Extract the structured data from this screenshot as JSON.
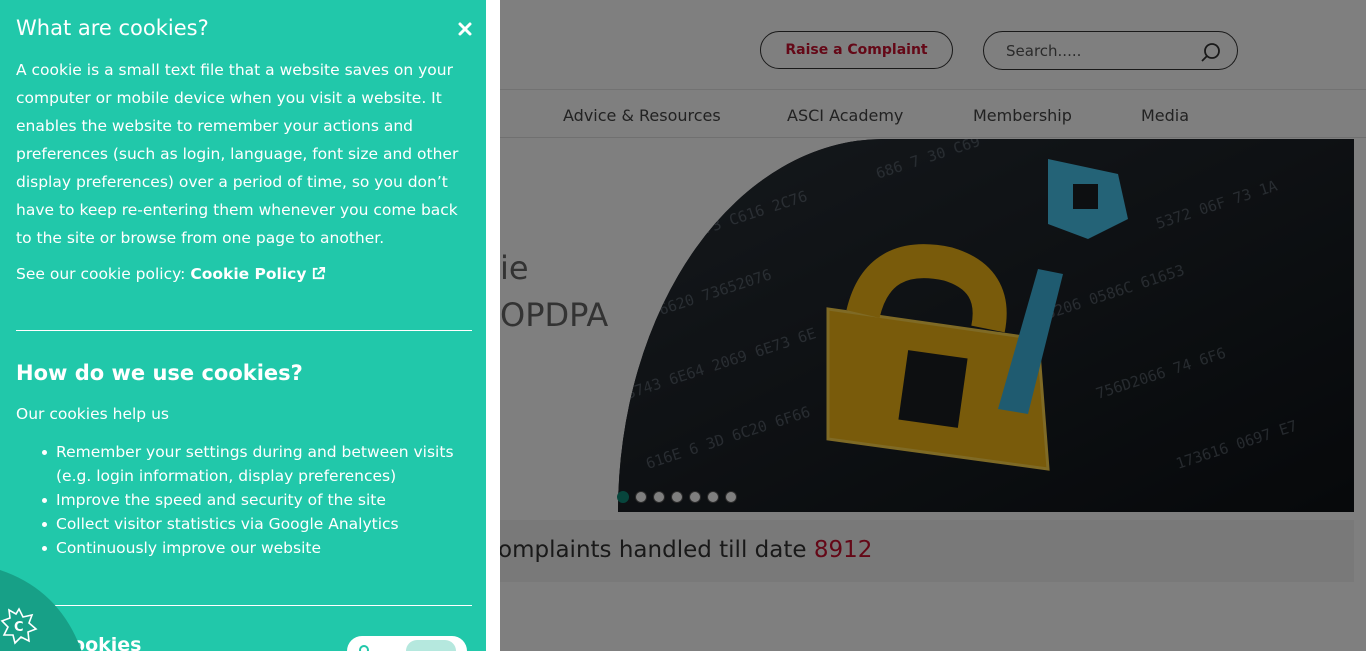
{
  "header": {
    "complaint_button": "Raise a Complaint",
    "search_placeholder": "Search....."
  },
  "nav": {
    "items": [
      "Advice & Resources",
      "ASCI Academy",
      "Membership",
      "Media"
    ]
  },
  "hero": {
    "line1": "ie",
    "line2": "OPDPA"
  },
  "stats": {
    "label": "omplaints handled till date",
    "value": "8912"
  },
  "cookie_panel": {
    "title": "What are cookies?",
    "description": "A cookie is a small text file that a website saves on your computer or mobile device when you visit a website. It enables the website to remember your actions and preferences (such as login, language, font size and other display preferences) over a period of time, so you don’t have to keep re-entering them whenever you come back to the site or browse from one page to another.",
    "policy_prefix": "See our cookie policy:",
    "policy_link": "Cookie Policy",
    "how_title": "How do we use cookies?",
    "help_text": "Our cookies help us",
    "bullets": [
      "Remember your settings during and between visits (e.g. login information, display preferences)",
      "Improve the speed and security of the site",
      "Collect visitor statistics via Google Analytics",
      "Continuously improve our website"
    ],
    "analytics_title": "tics cookies"
  },
  "colors": {
    "panel_bg": "#21c8aa",
    "accent_red": "#c8102e",
    "active_dot": "#0f8a78"
  },
  "icons": {
    "close": "close-icon",
    "external": "external-link-icon",
    "search": "search-icon",
    "cookie_badge": "cookie-badge-icon"
  }
}
